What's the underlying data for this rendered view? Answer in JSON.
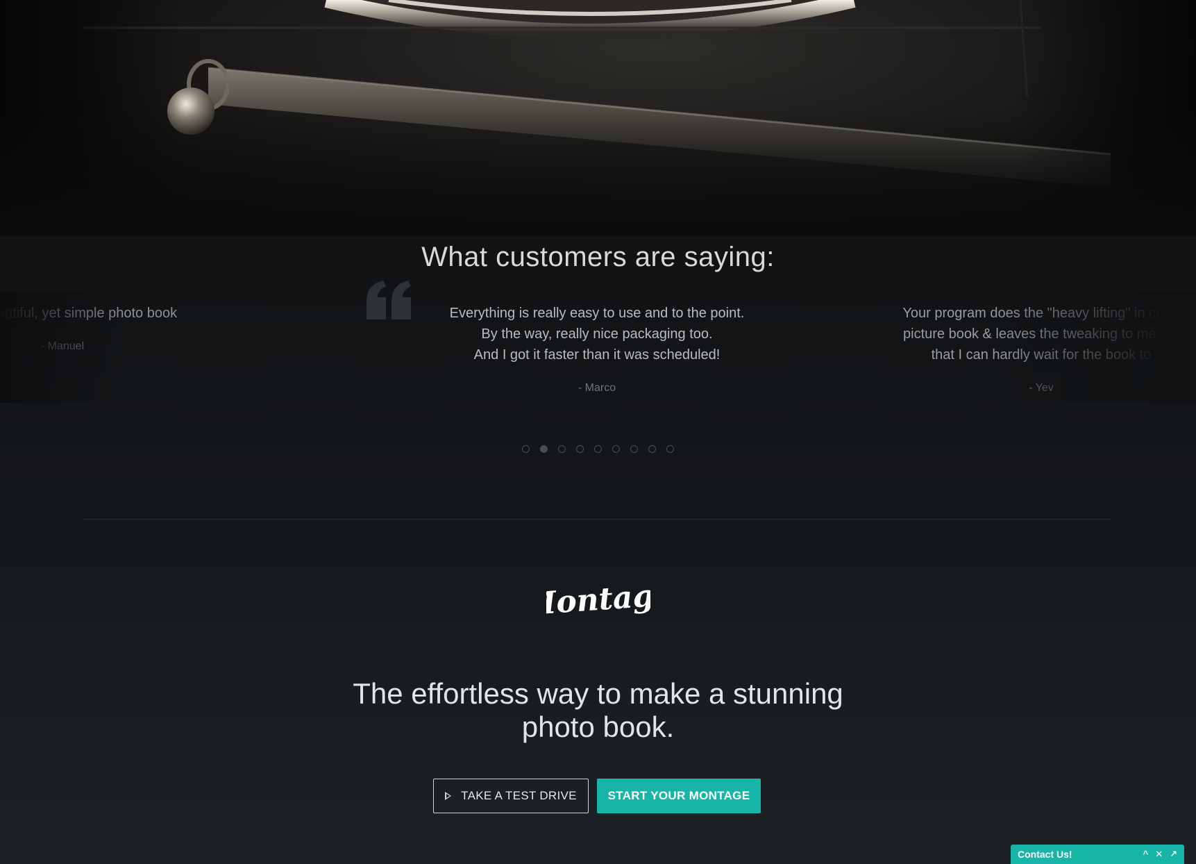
{
  "testimonials_section": {
    "title": "What customers are saying:",
    "items": [
      {
        "lines": [
          "tterly beautiful, yet simple photo book"
        ],
        "author": "- Manuel"
      },
      {
        "lines": [
          "Everything is really easy to use and to the point.",
          "By the way, really nice packaging too.",
          "And I got it faster than it was scheduled!"
        ],
        "author": "- Marco"
      },
      {
        "lines": [
          "Your program does the \"heavy lifting\" in creat",
          "picture book & leaves the tweaking to me. I a",
          "that I can hardly wait for the book to"
        ],
        "author": "- Yev"
      }
    ],
    "pagination": {
      "total": 9,
      "active": 2
    }
  },
  "footer": {
    "logo_text": "Montage",
    "tagline_line1": "The effortless way to make a stunning",
    "tagline_line2": "photo book.",
    "test_drive_label": "TAKE A TEST DRIVE",
    "start_label": "START YOUR MONTAGE"
  },
  "contact_widget": {
    "label": "Contact Us!",
    "minimize_icon": "^",
    "close_icon": "✕",
    "popout_icon": "↗"
  },
  "colors": {
    "accent": "#17b5a7",
    "background": "#141619"
  }
}
